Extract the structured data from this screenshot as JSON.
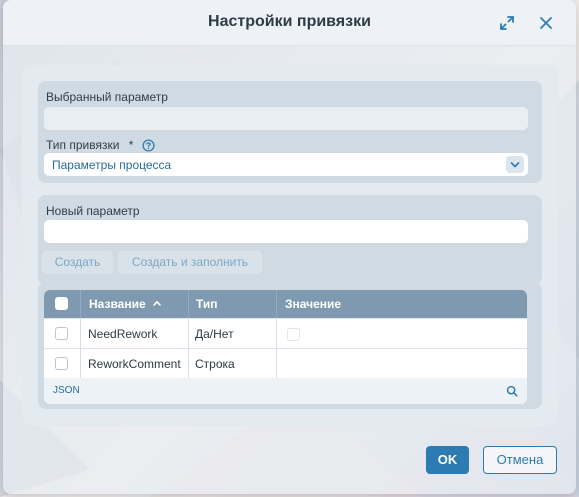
{
  "dialog": {
    "title": "Настройки привязки",
    "icons": {
      "expand": "expand-icon",
      "close": "close-icon"
    }
  },
  "selected_param": {
    "label": "Выбранный параметр",
    "value": ""
  },
  "binding_type": {
    "label": "Тип привязки",
    "required_mark": "*",
    "help_icon": "help-icon",
    "value": "Параметры процесса"
  },
  "new_param": {
    "label": "Новый параметр",
    "value": "",
    "create_label": "Создать",
    "create_fill_label": "Создать и заполнить"
  },
  "table": {
    "columns": [
      "Название",
      "Тип",
      "Значение"
    ],
    "sort_icon": "sort-asc-icon",
    "rows": [
      {
        "name": "NeedRework",
        "type": "Да/Нет",
        "value": ""
      },
      {
        "name": "ReworkComment",
        "type": "Строка",
        "value": ""
      }
    ],
    "footer_label": "JSON",
    "search_icon": "search-icon"
  },
  "footer": {
    "ok_label": "OK",
    "cancel_label": "Отмена"
  },
  "colors": {
    "accent": "#2d7bb3",
    "table_header": "#7f9ab0",
    "link_text": "#2a6c98"
  }
}
